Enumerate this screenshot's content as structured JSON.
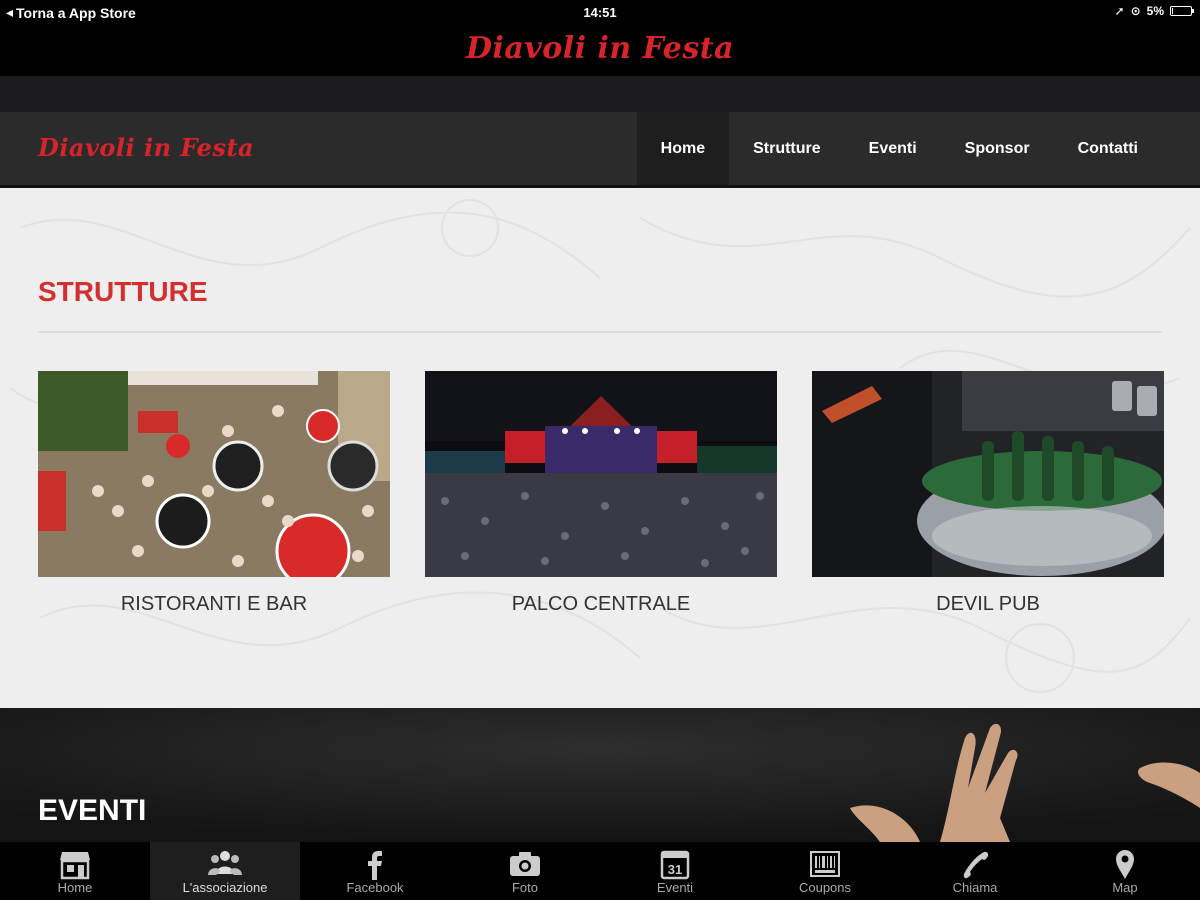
{
  "status_bar": {
    "back_label": "Torna a App Store",
    "time": "14:51",
    "battery": "5%",
    "battery_level": 0.05
  },
  "app_header": {
    "logo_text": "Diavoli in Festa"
  },
  "site_nav": {
    "logo_text": "Diavoli in Festa",
    "items": [
      {
        "label": "Home",
        "active": true
      },
      {
        "label": "Strutture"
      },
      {
        "label": "Eventi"
      },
      {
        "label": "Sponsor"
      },
      {
        "label": "Contatti"
      }
    ]
  },
  "strutture": {
    "title": "STRUTTURE",
    "cards": [
      {
        "label": "RISTORANTI E BAR"
      },
      {
        "label": "PALCO CENTRALE"
      },
      {
        "label": "DEVIL PUB"
      }
    ]
  },
  "eventi": {
    "title": "EVENTI"
  },
  "tab_bar": {
    "items": [
      {
        "label": "Home",
        "icon": "store-icon"
      },
      {
        "label": "L'associazione",
        "icon": "group-icon",
        "active": true
      },
      {
        "label": "Facebook",
        "icon": "facebook-icon"
      },
      {
        "label": "Foto",
        "icon": "camera-icon"
      },
      {
        "label": "Eventi",
        "icon": "calendar-icon",
        "calendar_day": "31"
      },
      {
        "label": "Coupons",
        "icon": "barcode-icon"
      },
      {
        "label": "Chiama",
        "icon": "phone-icon"
      },
      {
        "label": "Map",
        "icon": "map-pin-icon"
      }
    ]
  },
  "colors": {
    "brand_red": "#d32f2f",
    "nav_bg": "#2b2b2b",
    "content_bg": "#eeeeee"
  }
}
